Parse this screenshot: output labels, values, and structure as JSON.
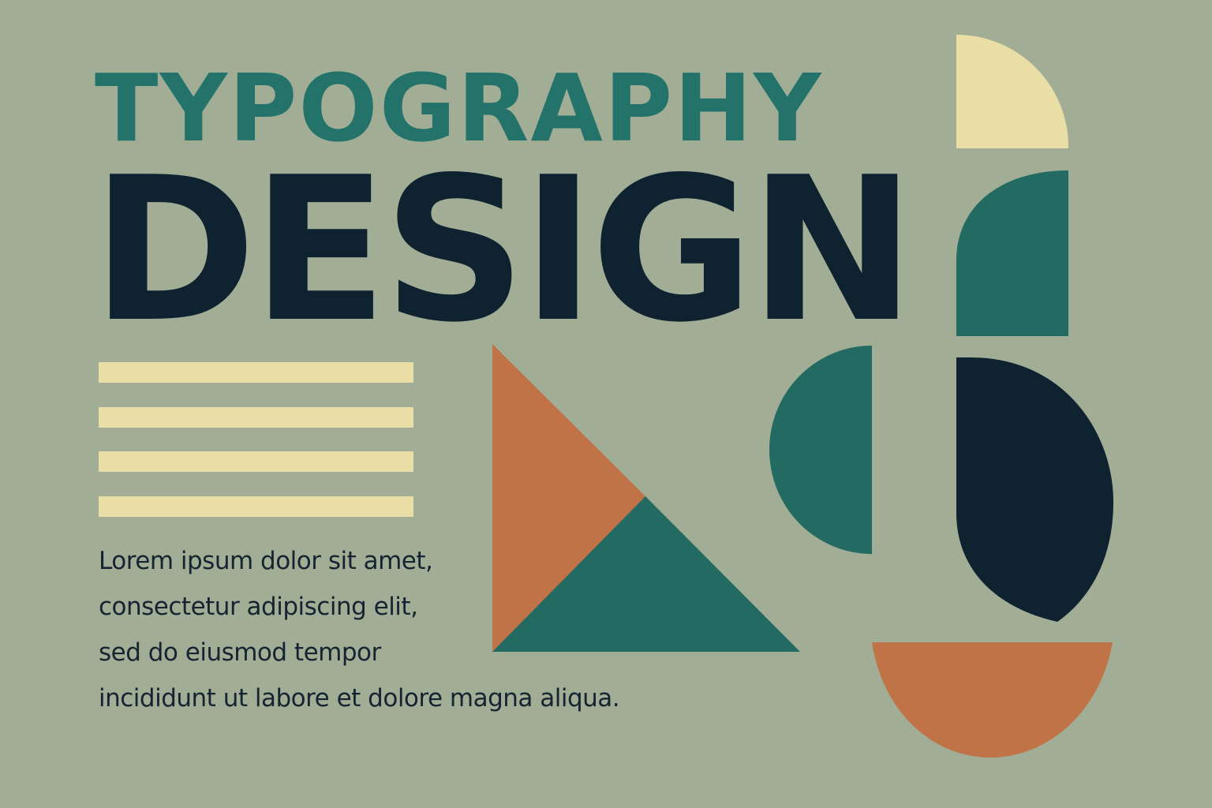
{
  "headline": {
    "top": "TYPOGRAPHY",
    "main": "DESIGN"
  },
  "body_lines": [
    "Lorem ipsum dolor sit amet,",
    "consectetur adipiscing elit,",
    "sed do eiusmod tempor",
    "incididunt ut labore et dolore magna aliqua."
  ],
  "colors": {
    "background": "#a2ad96",
    "teal": "#24736a",
    "teal_dark": "#236a62",
    "navy": "#0f2230",
    "cream": "#e9dfa6",
    "orange": "#c07347"
  }
}
